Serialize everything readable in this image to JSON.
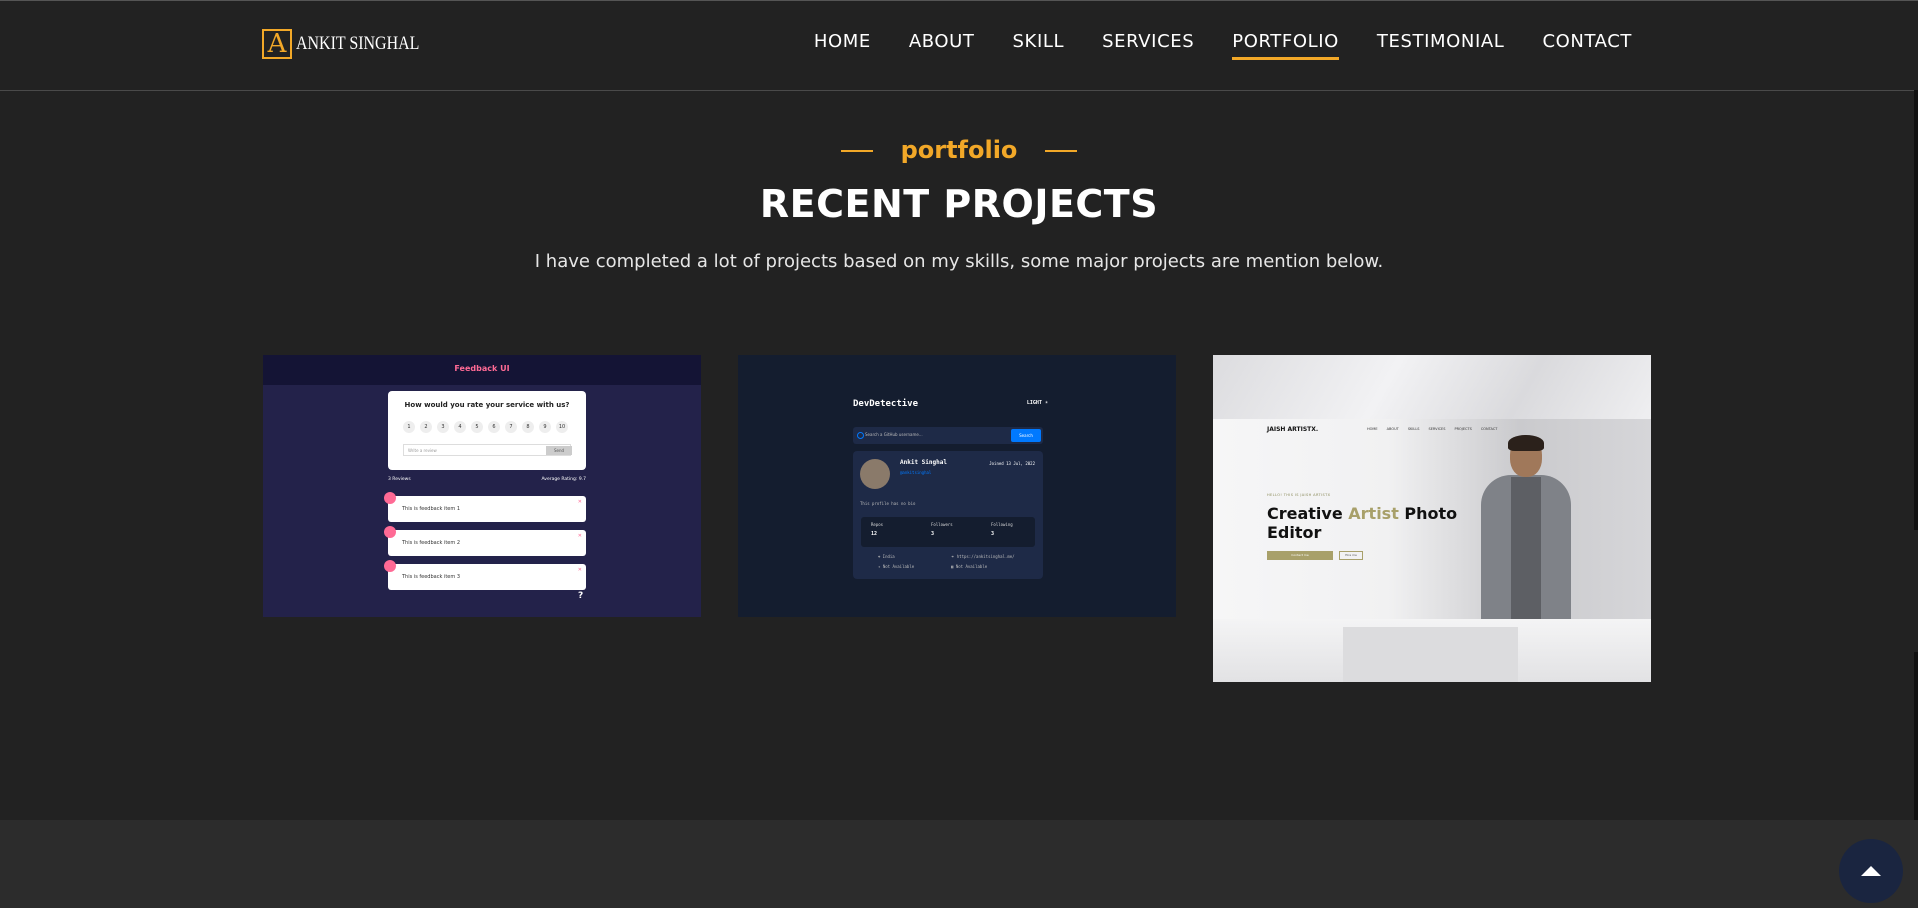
{
  "header": {
    "logo_letter": "A",
    "logo_text": "ANKIT SINGHAL",
    "accent_color": "#f2a828",
    "nav": [
      {
        "label": "HOME"
      },
      {
        "label": "ABOUT"
      },
      {
        "label": "SKILL"
      },
      {
        "label": "SERVICES"
      },
      {
        "label": "PORTFOLIO",
        "active": true
      },
      {
        "label": "TESTIMONIAL"
      },
      {
        "label": "CONTACT"
      }
    ]
  },
  "section": {
    "eyebrow": "portfolio",
    "title": "RECENT PROJECTS",
    "subtitle": "I have completed a lot of projects based on my skills, some major projects are mention below."
  },
  "projects": [
    {
      "name": "Feedback UI",
      "question": "How would you rate your service with us?",
      "ratings": [
        "1",
        "2",
        "3",
        "4",
        "5",
        "6",
        "7",
        "8",
        "9",
        "10"
      ],
      "review_placeholder": "Write a review",
      "send_label": "Send",
      "review_count": "3 Reviews",
      "average": "Average Rating: 9.7",
      "items": [
        "This is feedback item 1",
        "This is feedback item 2",
        "This is feedback item 3"
      ],
      "help": "?"
    },
    {
      "name": "DevDetective",
      "theme_toggle": "LIGHT",
      "search_placeholder": "Search a GitHub username...",
      "search_button": "Search",
      "user_name": "Ankit Singhal",
      "user_handle": "@ankitsinghal",
      "joined": "Joined 13 Jul, 2022",
      "bio": "This profile has no bio",
      "stats": [
        {
          "label": "Repos",
          "value": "12"
        },
        {
          "label": "Followers",
          "value": "3"
        },
        {
          "label": "Following",
          "value": "3"
        }
      ],
      "location": "India",
      "twitter": "Not Available",
      "website": "https://ankitsinghal.me/",
      "company": "Not Available"
    },
    {
      "name": "Photo Editor",
      "brand": "JAISH ARTISTX.",
      "menu": [
        "HOME",
        "ABOUT",
        "SKILLS",
        "SERVICES",
        "PROJECTS",
        "CONTACT"
      ],
      "kicker": "HELLO! THIS IS JAISH ARTISTX",
      "headline_1": "Creative ",
      "headline_accent": "Artist",
      "headline_2": " Photo",
      "headline_3": "Editor",
      "button_primary": "Contact me",
      "button_secondary": "Hire me"
    }
  ],
  "back_to_top_icon": "arrow-up-icon"
}
